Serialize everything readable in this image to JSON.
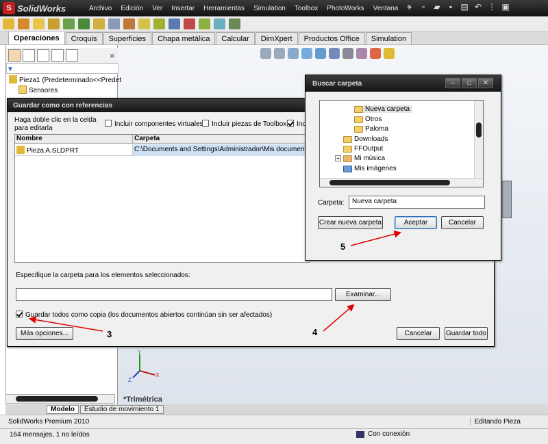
{
  "app": {
    "logo": "SolidWorks",
    "menus": [
      "Archivo",
      "Edición",
      "Ver",
      "Insertar",
      "Herramientas",
      "Simulation",
      "Toolbox",
      "PhotoWorks",
      "Ventana",
      "?"
    ]
  },
  "tabs": [
    "Operaciones",
    "Croquis",
    "Superficies",
    "Chapa metálica",
    "Calcular",
    "DimXpert",
    "Productos Office",
    "Simulation"
  ],
  "tree": {
    "part": "Pieza1  (Predeterminado<<Predet",
    "sensors": "Sensores"
  },
  "graphics": {
    "view_label": "*Trimétrica",
    "axis_x": "X",
    "axis_y": "Y",
    "axis_z": "Z"
  },
  "bottom_tabs": [
    "Modelo",
    "Estudio de movimiento 1"
  ],
  "status": {
    "product": "SolidWorks Premium 2010",
    "mode": "Editando Pieza",
    "messages": "164 mensajes, 1 no leídos",
    "connection": "Con conexión"
  },
  "saveas": {
    "title": "Guardar como con referencias",
    "hint": "Haga doble clic en la celda para editarla",
    "cb_virtual": "Incluir componentes virtuales",
    "cb_toolbox": "Incluir piezas de Toolbox",
    "cb_third": "Inclu",
    "col_name": "Nombre",
    "col_folder": "Carpeta",
    "row_name": "Pieza A.SLDPRT",
    "row_folder": "C:\\Documents and Settings\\Administrador\\Mis documentos\\De",
    "specify": "Especifique la carpeta para los elementos seleccionados:",
    "path_value": "",
    "browse_btn": "Examinar...",
    "save_copy": "Guardar todos como copia (los documentos abiertos continúan sin ser afectados)",
    "more_btn": "Más opciones...",
    "cancel_btn": "Cancelar",
    "save_all_btn": "Guardar todo"
  },
  "browse": {
    "title": "Buscar carpeta",
    "nodes": [
      "Nueva carpeta",
      "Otros",
      "Paloma",
      "Downloads",
      "FFOutput",
      "Mi música",
      "Mis imágenes"
    ],
    "folder_label": "Carpeta:",
    "folder_value": "Nueva carpeta",
    "new_btn": "Crear nueva carpeta",
    "ok_btn": "Aceptar",
    "cancel_btn": "Cancelar"
  },
  "annotations": {
    "n3": "3",
    "n4": "4",
    "n5": "5"
  },
  "colors": {
    "arrow": "#e00000",
    "titlebar": "#1e1e1e",
    "selection": "#cfe0f5"
  }
}
